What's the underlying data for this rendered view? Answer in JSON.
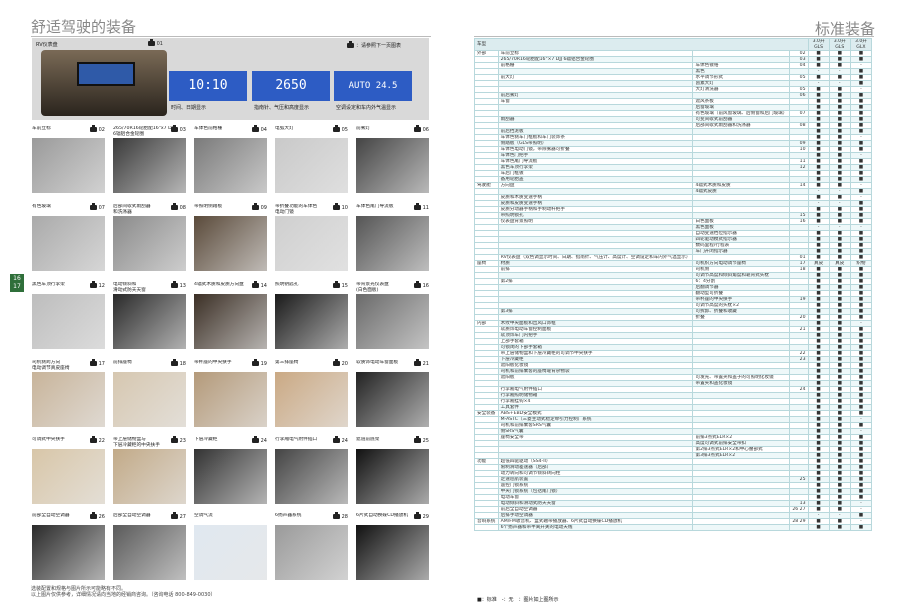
{
  "left_title": "舒适驾驶的装备",
  "right_title": "标准装备",
  "page_num": "16\n17",
  "rv": {
    "label": "RV仪表盘",
    "num": "01",
    "note": "：请参照下一页图表",
    "clock": "10:10",
    "time_sub": "24.01 2001",
    "compass": "2650",
    "auto": "AUTO 24.5",
    "cap1": "时间、日期显示",
    "cap2": "指南针、气压和高度显示",
    "cap3": "空调设定和车内外气温显示"
  },
  "tiles": [
    {
      "cap": "车前立标",
      "num": "02"
    },
    {
      "cap": "265/70R16轮胎配16\"x7 DJJ\n6辐铝合金轮圈",
      "num": "03"
    },
    {
      "cap": "车体色前格栅",
      "num": "04"
    },
    {
      "cap": "电弧大灯",
      "num": "05"
    },
    {
      "cap": "前雾灯",
      "num": "06"
    },
    {
      "cap": "有色玻璃",
      "num": "07"
    },
    {
      "cap": "后部间歇式雨刮器\n和洗涤器",
      "num": "08"
    },
    {
      "cap": "带照明侧踏板",
      "num": "09"
    },
    {
      "cap": "带折叠功能的车体色\n电动门镜",
      "num": "10"
    },
    {
      "cap": "车体色尾门导流板",
      "num": "11"
    },
    {
      "cap": "黑色车顶行李架",
      "num": "12"
    },
    {
      "cap": "电动倾斜和\n滑动式防天天窗",
      "num": "13"
    },
    {
      "cap": "4辐式木质和皮质方向盘",
      "num": "14"
    },
    {
      "cap": "照明钥匙孔",
      "num": "15"
    },
    {
      "cap": "带背景光仪表盘\n(白色面板)",
      "num": "16"
    },
    {
      "cap": "司机侧跨方向\n电动调节真皮座椅",
      "num": "17"
    },
    {
      "cap": "前排座椅",
      "num": "18"
    },
    {
      "cap": "带杯座的中央扶手",
      "num": "19"
    },
    {
      "cap": "第三排座椅",
      "num": "20"
    },
    {
      "cap": "软质饰电动车窗面板",
      "num": "21"
    },
    {
      "cap": "可调式中央扶手",
      "num": "22"
    },
    {
      "cap": "带上层储物盒与\n下层冷藏柜的中央扶手",
      "num": "23"
    },
    {
      "cap": "下层冷藏柜",
      "num": "24"
    },
    {
      "cap": "行李厢电气附件插口",
      "num": "24"
    },
    {
      "cap": "遮道前底架",
      "num": "25"
    },
    {
      "cap": "前部全自动空调器",
      "num": "26"
    },
    {
      "cap": "后部全自动空调器",
      "num": "27"
    },
    {
      "cap": "空调气流",
      "num": ""
    },
    {
      "cap": "6扬声器系统",
      "num": "28"
    },
    {
      "cap": "6片式自动换碟CD播放机",
      "num": "29"
    }
  ],
  "footnote": [
    "选装配置和规格与图片所示可能略有不同。",
    "以上图片仅供参考，详细情况请向当地的经销商咨询。（咨询电话 800-849-0030）"
  ],
  "table": {
    "h_cat": "车型",
    "h_models": [
      "3.0升\nGLS",
      "3.0升\nGLS",
      "3.0升\nGLX"
    ],
    "rows": [
      [
        "外部",
        "车前立标",
        "02",
        "■",
        "■",
        "■"
      ],
      [
        "",
        "265/70R16轮胎配16\"×7 DJJ 6辐铝合金轮圈",
        "03",
        "■",
        "■",
        "■"
      ],
      [
        "",
        "前格栅",
        "车体色镀铬",
        "04",
        "■",
        "■",
        "-"
      ],
      [
        "",
        "",
        "黑色",
        "",
        "-",
        "-",
        "■"
      ],
      [
        "",
        "前大灯",
        "水平调节形式",
        "05",
        "■",
        "■",
        "■"
      ],
      [
        "",
        "",
        "卤素大灯",
        "",
        "-",
        "-",
        "■"
      ],
      [
        "",
        "",
        "大灯清洗器",
        "05",
        "■",
        "■",
        "-"
      ],
      [
        "",
        "前后雾灯",
        "",
        "06",
        "■",
        "■",
        "■"
      ],
      [
        "",
        "车窗",
        "遮风条板",
        "",
        "■",
        "■",
        "■"
      ],
      [
        "",
        "",
        "后窗玻璃",
        "",
        "■",
        "■",
        "■"
      ],
      [
        "",
        "",
        "有色玻璃（前风窗玻璃、后侧窗和后门玻璃）",
        "07",
        "■",
        "■",
        "■"
      ],
      [
        "",
        "雨刮器",
        "可变间歇式前刮器",
        "",
        "■",
        "■",
        "■"
      ],
      [
        "",
        "",
        "后部间歇式雨刮器和洗涤器",
        "08",
        "■",
        "■",
        "■"
      ],
      [
        "",
        "前后挡泥板",
        "",
        "",
        "■",
        "■",
        "■"
      ],
      [
        "",
        "车体色侧车门框板和车门装饰条",
        "",
        "",
        "■",
        "■",
        "-"
      ],
      [
        "",
        "侧踏板（GLS带照明）",
        "",
        "09",
        "■",
        "■",
        "■"
      ],
      [
        "",
        "车体色电动门镜，带除雾器可折叠",
        "",
        "10",
        "■",
        "■",
        "■"
      ],
      [
        "",
        "车体色门把手",
        "",
        "",
        "■",
        "■",
        "-"
      ],
      [
        "",
        "车体色尾门导流板",
        "",
        "11",
        "■",
        "■",
        "■"
      ],
      [
        "",
        "黑色车顶行李架",
        "",
        "12",
        "■",
        "■",
        "■"
      ],
      [
        "",
        "车后门框镀",
        "",
        "",
        "■",
        "■",
        "■"
      ],
      [
        "",
        "备用轮胎盖",
        "",
        "",
        "■",
        "■",
        "■"
      ],
      [
        "驾驶舱",
        "方向盘",
        "4辐式木质和皮质",
        "14",
        "■",
        "■",
        "-"
      ],
      [
        "",
        "",
        "4辐式皮质",
        "",
        "-",
        "-",
        "■"
      ],
      [
        "",
        "皮质和木质变速手柄",
        "",
        "",
        "■",
        "■",
        "-"
      ],
      [
        "",
        "皮质和皮质变速手柄",
        "",
        "",
        "-",
        "-",
        "■"
      ],
      [
        "",
        "皮质分动器手柄和手制动杆把手",
        "",
        "",
        "■",
        "■",
        "■"
      ],
      [
        "",
        "带照明锁孔",
        "",
        "15",
        "■",
        "■",
        "■"
      ],
      [
        "",
        "仪表盘背景照明",
        "白色面板",
        "16",
        "■",
        "■",
        "■"
      ],
      [
        "",
        "",
        "黑色面板",
        "",
        "-",
        "-",
        "-"
      ],
      [
        "",
        "",
        "自动变速档位指示器",
        "",
        "■",
        "■",
        "■"
      ],
      [
        "",
        "",
        "四轮驱动模式指示器",
        "",
        "■",
        "■",
        "■"
      ],
      [
        "",
        "",
        "数码里程/行程表",
        "",
        "■",
        "■",
        "■"
      ],
      [
        "",
        "",
        "车门开闭指示器",
        "",
        "■",
        "■",
        "■"
      ],
      [
        "",
        "RV仪表盘（双色调显示时间、日期、指南针、气压计、高度计、空调设定和车内外气温显示）",
        "",
        "01",
        "■",
        "■",
        "■"
      ],
      [
        "座椅",
        "材质",
        "可机织方向电动调节座椅",
        "17",
        "真皮",
        "真皮",
        "织物"
      ],
      [
        "",
        "前排",
        "司机侧",
        "18",
        "■",
        "■",
        "■"
      ],
      [
        "",
        "",
        "可调节高度和倾斜角度和靠背式头枕",
        "",
        "■",
        "■",
        "■"
      ],
      [
        "",
        "第2排",
        "6：4分割",
        "",
        "■",
        "■",
        "■"
      ],
      [
        "",
        "",
        "后翻调节器",
        "",
        "■",
        "■",
        "■"
      ],
      [
        "",
        "",
        "翻动型可折叠",
        "",
        "■",
        "■",
        "■"
      ],
      [
        "",
        "",
        "带杯座的中央扶手",
        "19",
        "■",
        "■",
        "■"
      ],
      [
        "",
        "",
        "可调节高度的头枕×2",
        "",
        "■",
        "■",
        "■"
      ],
      [
        "",
        "第3排",
        "可拆卸、折叠和收藏",
        "",
        "■",
        "■",
        "■"
      ],
      [
        "",
        "",
        "折叠",
        "20",
        "■",
        "■",
        "■"
      ],
      [
        "内部",
        "木纹中央面板和出风口饰框",
        "",
        "",
        "■",
        "■",
        "-"
      ],
      [
        "",
        "软质饰电动车窗控制面板",
        "",
        "21",
        "■",
        "■",
        "■"
      ],
      [
        "",
        "软顶饰车门内把手",
        "",
        "",
        "■",
        "■",
        "■"
      ],
      [
        "",
        "上部手套箱",
        "",
        "",
        "■",
        "■",
        "■"
      ],
      [
        "",
        "可锁闭的下部手套箱",
        "",
        "",
        "■",
        "■",
        "■"
      ],
      [
        "",
        "带上层储物盒和下层冷藏柜的可调节中央扶手",
        "",
        "22",
        "■",
        "■",
        "■"
      ],
      [
        "",
        "下层冷藏柜",
        "",
        "23",
        "■",
        "■",
        "■"
      ],
      [
        "",
        "遮阳板化妆镜",
        "",
        "",
        "■",
        "■",
        "■"
      ],
      [
        "",
        "司机和前排乘客的座椅靠背杂物袋",
        "",
        "",
        "■",
        "■",
        "■"
      ],
      [
        "",
        "遮阳板",
        "可发光、带置夹和盖子的可照明化妆镜",
        "",
        "■",
        "■",
        "■"
      ],
      [
        "",
        "",
        "带置夹和盖化妆镜",
        "",
        "■",
        "■",
        "■"
      ],
      [
        "",
        "行李厢电气附件插口",
        "",
        "24",
        "■",
        "■",
        "■"
      ],
      [
        "",
        "行李厢照明储物箱",
        "",
        "",
        "■",
        "■",
        "■"
      ],
      [
        "",
        "行李厢挂钩×4",
        "",
        "",
        "■",
        "■",
        "■"
      ],
      [
        "",
        "工具套件",
        "",
        "",
        "■",
        "■",
        "■"
      ],
      [
        "安全装备",
        "ABS+EBD安全模式",
        "",
        "",
        "■",
        "■",
        "■"
      ],
      [
        "",
        "M-ASTC（三菱主动式稳定牵引力控制）系统",
        "",
        "",
        "■",
        "■",
        "-"
      ],
      [
        "",
        "司机和前排乘客SRS气囊",
        "",
        "",
        "■",
        "■",
        "■"
      ],
      [
        "",
        "侧SRS气囊",
        "",
        "",
        "■",
        "■",
        "-"
      ],
      [
        "",
        "座椅安全带",
        "前排3点式ELR×2",
        "",
        "■",
        "■",
        "■"
      ],
      [
        "",
        "",
        "高度可调式前排安全带扣",
        "",
        "■",
        "■",
        "■"
      ],
      [
        "",
        "",
        "第2排3点式ELR×2和中心腰部式",
        "",
        "■",
        "■",
        "■"
      ],
      [
        "",
        "",
        "第3排3点式ELR×2",
        "",
        "■",
        "■",
        "■"
      ],
      [
        "功能",
        "超低四驱驱动（SS4-II）",
        "",
        "",
        "■",
        "■",
        "■"
      ],
      [
        "",
        "限制滑动差速器（后部）",
        "",
        "",
        "■",
        "■",
        "■"
      ],
      [
        "",
        "动力转向和可调节倾斜转向柱",
        "",
        "",
        "■",
        "■",
        "■"
      ],
      [
        "",
        "定速巡航装置",
        "",
        "25",
        "■",
        "■",
        "■"
      ],
      [
        "",
        "遥控门锁系统",
        "",
        "",
        "■",
        "■",
        "■"
      ],
      [
        "",
        "中央门锁系统（包括尾门锁）",
        "",
        "",
        "■",
        "■",
        "■"
      ],
      [
        "",
        "电动车窗",
        "",
        "",
        "■",
        "■",
        "■"
      ],
      [
        "",
        "电动倾斜和滑动式防天天窗",
        "",
        "13",
        "■",
        "■",
        "-"
      ],
      [
        "",
        "前后全自动空调器",
        "",
        "26 27",
        "■",
        "■",
        "-"
      ],
      [
        "",
        "后排手动空调器",
        "",
        "",
        "-",
        "-",
        "■"
      ],
      [
        "音响系统",
        "AM/FM收音机、盒式磁带播放器、6片式自动换碟CD播放机",
        "",
        "28 29",
        "■",
        "■",
        "-"
      ],
      [
        "",
        "6个扬声器和带半离开关的电动天线",
        "",
        "",
        "■",
        "■",
        "■"
      ]
    ]
  },
  "legend": "■：标准　-：无　：图片如上图所示"
}
